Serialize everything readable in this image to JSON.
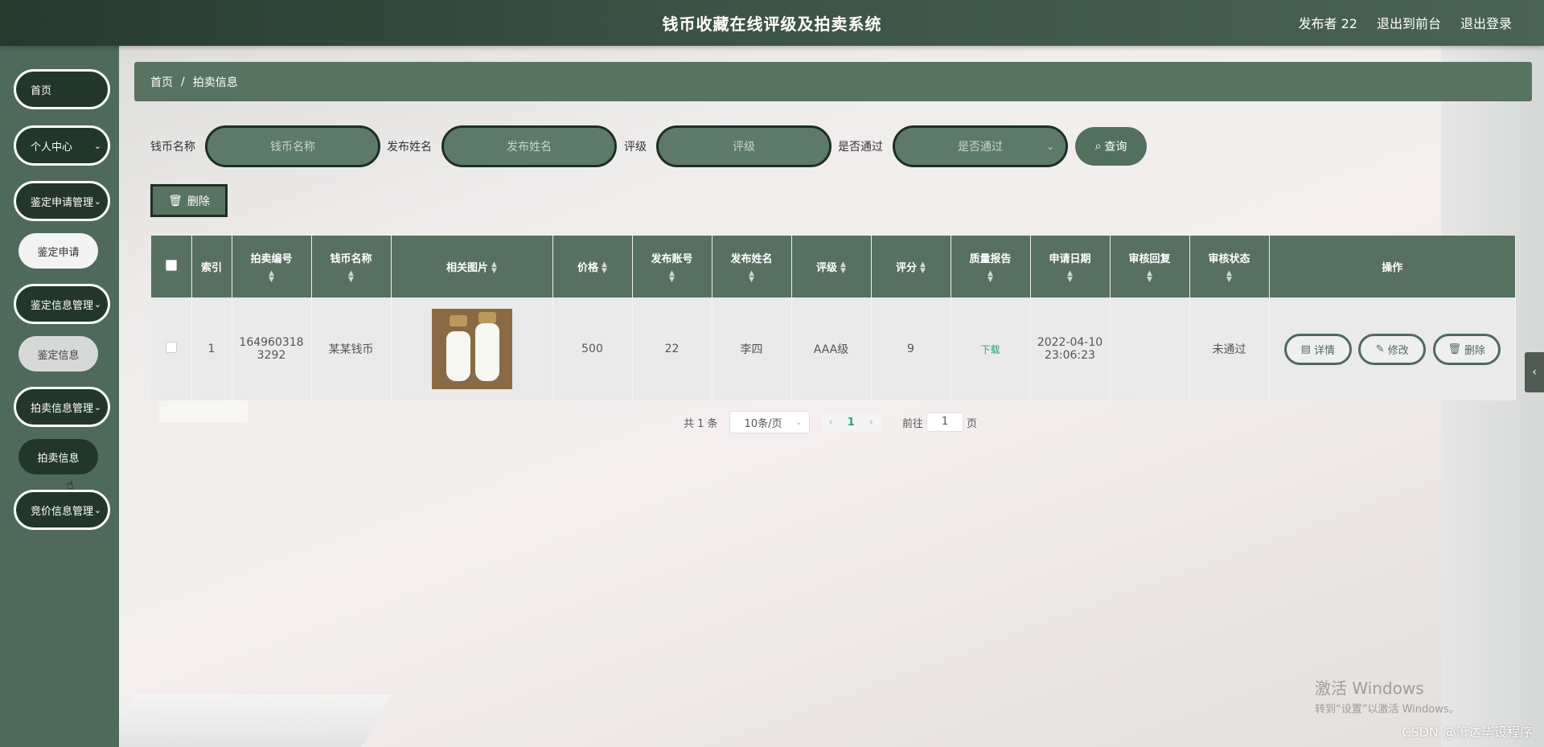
{
  "header": {
    "title": "钱币收藏在线评级及拍卖系统",
    "user": "发布者 22",
    "front_link": "退出到前台",
    "logout": "退出登录"
  },
  "sidebar": {
    "items": [
      {
        "label": "首页"
      },
      {
        "label": "个人中心"
      },
      {
        "label": "鉴定申请管理"
      },
      {
        "label": "鉴定申请"
      },
      {
        "label": "鉴定信息管理"
      },
      {
        "label": "鉴定信息"
      },
      {
        "label": "拍卖信息管理"
      },
      {
        "label": "拍卖信息"
      },
      {
        "label": "竞价信息管理"
      }
    ]
  },
  "breadcrumb": {
    "home": "首页",
    "sep": "/",
    "current": "拍卖信息"
  },
  "search": {
    "coin_name_label": "钱币名称",
    "coin_name_placeholder": "钱币名称",
    "publisher_label": "发布姓名",
    "publisher_placeholder": "发布姓名",
    "rating_label": "评级",
    "rating_placeholder": "评级",
    "passed_label": "是否通过",
    "passed_placeholder": "是否通过",
    "query_button": "查询"
  },
  "toolbar": {
    "delete_button": "删除"
  },
  "table": {
    "headers": [
      "索引",
      "拍卖编号",
      "钱币名称",
      "相关图片",
      "价格",
      "发布账号",
      "发布姓名",
      "评级",
      "评分",
      "质量报告",
      "申请日期",
      "审核回复",
      "审核状态",
      "操作"
    ],
    "rows": [
      {
        "index": "1",
        "auction_no_line1": "164960318",
        "auction_no_line2": "3292",
        "coin_name": "某某钱币",
        "price": "500",
        "account": "22",
        "name": "李四",
        "rating": "AAA级",
        "score": "9",
        "report": "下载",
        "date_line1": "2022-04-10",
        "date_line2": "23:06:23",
        "reply": "",
        "status": "未通过",
        "actions": {
          "detail": "详情",
          "edit": "修改",
          "delete": "删除"
        }
      }
    ]
  },
  "pagination": {
    "total": "共 1 条",
    "page_size": "10条/页",
    "current_page": "1",
    "goto_prefix": "前往",
    "goto_value": "1",
    "goto_suffix": "页"
  },
  "watermark": {
    "win_title": "激活 Windows",
    "win_sub": "转到“设置”以激活 Windows。",
    "csdn": "CSDN @箫达毕设程序"
  }
}
